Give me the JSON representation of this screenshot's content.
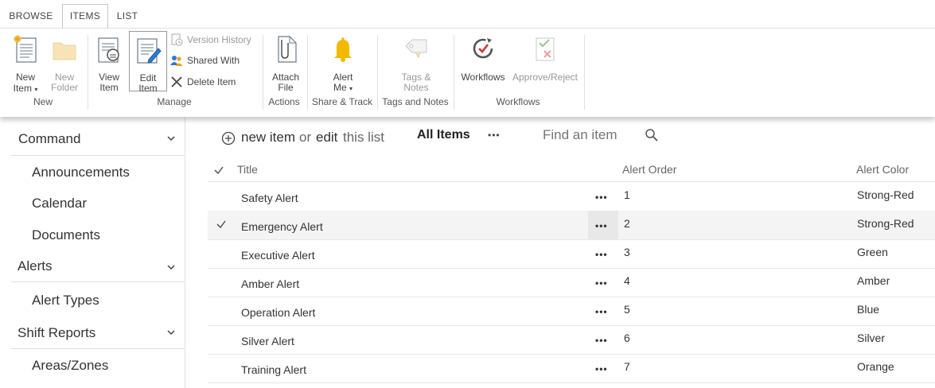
{
  "tabs": [
    {
      "label": "BROWSE",
      "selected": false
    },
    {
      "label": "ITEMS",
      "selected": true
    },
    {
      "label": "LIST",
      "selected": false
    }
  ],
  "ribbon": {
    "new_group": {
      "new_item_l1": "New",
      "new_item_l2": "Item",
      "new_folder_l1": "New",
      "new_folder_l2": "Folder",
      "label": "New"
    },
    "manage_group": {
      "view_item_l1": "View",
      "view_item_l2": "Item",
      "edit_item_l1": "Edit",
      "edit_item_l2": "Item",
      "version_history": "Version History",
      "shared_with": "Shared With",
      "delete_item": "Delete Item",
      "label": "Manage"
    },
    "actions_group": {
      "attach_l1": "Attach",
      "attach_l2": "File",
      "label": "Actions"
    },
    "share_group": {
      "alert_l1": "Alert",
      "alert_l2": "Me",
      "label": "Share & Track"
    },
    "tags_group": {
      "tags_l1": "Tags &",
      "tags_l2": "Notes",
      "label": "Tags and Notes"
    },
    "workflows_group": {
      "workflows": "Workflows",
      "approve_reject": "Approve/Reject",
      "label": "Workflows"
    }
  },
  "nav": {
    "command": "Command",
    "announcements": "Announcements",
    "calendar": "Calendar",
    "documents": "Documents",
    "alerts": "Alerts",
    "alert_types": "Alert Types",
    "shift_reports": "Shift Reports",
    "areas_zones": "Areas/Zones"
  },
  "toolbar": {
    "new_item": "new item",
    "or": "or",
    "edit": "edit",
    "this_list": "this list",
    "view_name": "All Items",
    "more": "•••",
    "search_placeholder": "Find an item"
  },
  "table": {
    "columns": [
      "Title",
      "Alert Order",
      "Alert Color"
    ],
    "rows": [
      {
        "title": "Safety Alert",
        "order": "1",
        "color": "Strong-Red",
        "selected": false
      },
      {
        "title": "Emergency Alert",
        "order": "2",
        "color": "Strong-Red",
        "selected": true
      },
      {
        "title": "Executive Alert",
        "order": "3",
        "color": "Green",
        "selected": false
      },
      {
        "title": "Amber Alert",
        "order": "4",
        "color": "Amber",
        "selected": false
      },
      {
        "title": "Operation Alert",
        "order": "5",
        "color": "Blue",
        "selected": false
      },
      {
        "title": "Silver Alert",
        "order": "6",
        "color": "Silver",
        "selected": false
      },
      {
        "title": "Training Alert",
        "order": "7",
        "color": "Orange",
        "selected": false
      }
    ],
    "row_menu": "•••"
  },
  "colors": {
    "link_blue": "#0072c6",
    "bell_yellow": "#f5b800",
    "accent_red": "#d13438"
  }
}
